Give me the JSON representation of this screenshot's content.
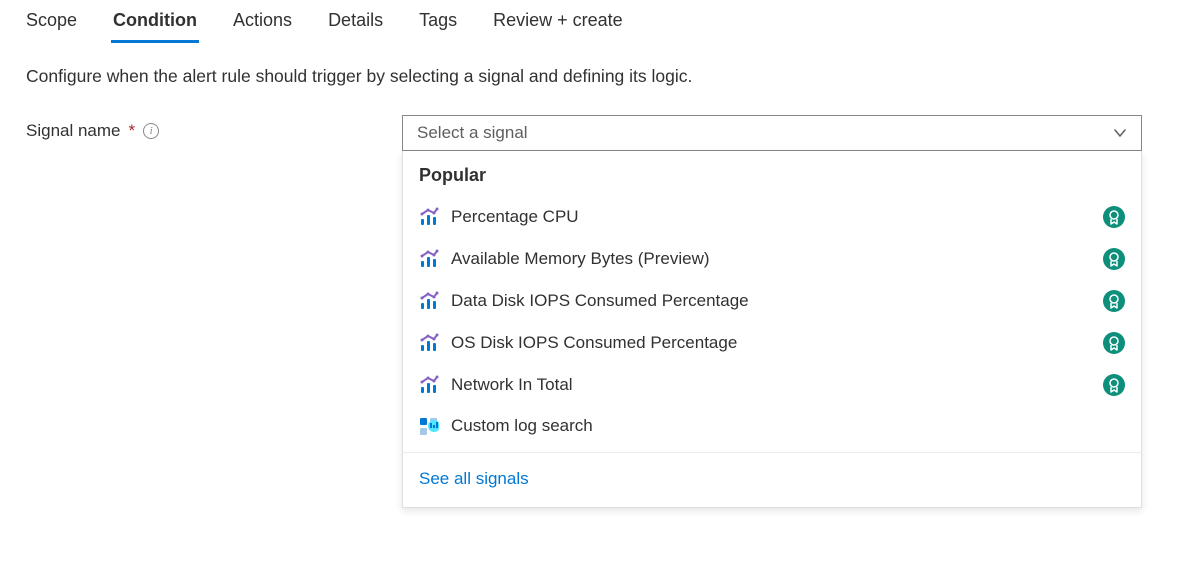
{
  "tabs": {
    "scope": "Scope",
    "condition": "Condition",
    "actions": "Actions",
    "details": "Details",
    "tags": "Tags",
    "review": "Review + create"
  },
  "description": "Configure when the alert rule should trigger by selecting a signal and defining its logic.",
  "signal": {
    "label": "Signal name",
    "placeholder": "Select a signal",
    "section_header": "Popular",
    "items": {
      "0": "Percentage CPU",
      "1": "Available Memory Bytes (Preview)",
      "2": "Data Disk IOPS Consumed Percentage",
      "3": "OS Disk IOPS Consumed Percentage",
      "4": "Network In Total",
      "5": "Custom log search"
    },
    "see_all": "See all signals"
  }
}
